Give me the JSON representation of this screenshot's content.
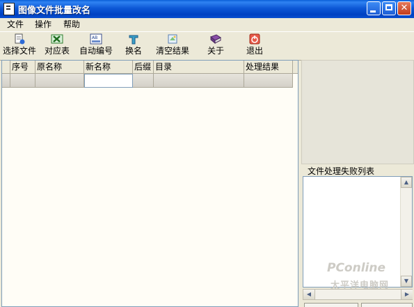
{
  "window": {
    "title": "图像文件批量改名",
    "controls": {
      "minimize_icon": "minimize-icon",
      "maximize_icon": "maximize-icon",
      "close_icon": "close-icon"
    }
  },
  "menubar": {
    "items": [
      {
        "label": "文件"
      },
      {
        "label": "操作"
      },
      {
        "label": "帮助"
      }
    ]
  },
  "toolbar": {
    "items": [
      {
        "label": "选择文件",
        "icon": "select-files-icon"
      },
      {
        "label": "对应表",
        "icon": "excel-table-icon"
      },
      {
        "label": "自动编号",
        "icon": "auto-number-icon"
      },
      {
        "label": "换名",
        "icon": "rename-icon"
      },
      {
        "label": "清空结果",
        "icon": "clear-results-icon"
      },
      {
        "label": "关于",
        "icon": "about-book-icon"
      },
      {
        "label": "退出",
        "icon": "exit-power-icon"
      }
    ]
  },
  "grid": {
    "columns": [
      "",
      "序号",
      "原名称",
      "新名称",
      "后缀",
      "目录",
      "处理结果"
    ]
  },
  "fail_panel": {
    "title": "文件处理失败列表"
  },
  "watermark": {
    "line1": "PConline",
    "line2": "太平洋电脑网"
  },
  "colors": {
    "titlebar": "#0a5fd8",
    "window_bg": "#ece9d8",
    "grid_bg": "#fffdf6",
    "close_red": "#c33c1b"
  }
}
